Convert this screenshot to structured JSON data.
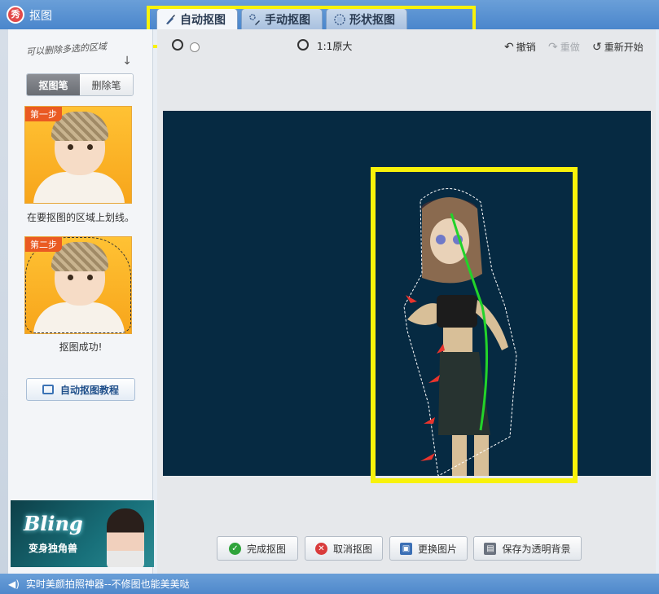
{
  "window": {
    "title": "抠图",
    "logo_text": "秀"
  },
  "tabs": [
    {
      "label": "自动抠图",
      "icon": "brush-icon",
      "active": true
    },
    {
      "label": "手动抠图",
      "icon": "pen-icon",
      "active": false
    },
    {
      "label": "形状抠图",
      "icon": "shape-icon",
      "active": false
    }
  ],
  "left_panel": {
    "hint": "可以删除多选的区域",
    "brushes": [
      {
        "label": "抠图笔",
        "selected": true
      },
      {
        "label": "删除笔",
        "selected": false
      }
    ],
    "steps": [
      {
        "badge": "第一步",
        "caption": "在要抠图的区域上划线。"
      },
      {
        "badge": "第二步",
        "caption": "抠图成功!"
      }
    ],
    "tutorial_label": "自动抠图教程",
    "ad": {
      "title": "Bling",
      "subtitle": "变身独角兽"
    }
  },
  "toolbar": {
    "zoom_label": "1:1原大",
    "undo_label": "撤销",
    "redo_label": "重做",
    "restart_label": "重新开始"
  },
  "canvas": {
    "background": "#062a42",
    "highlight_color": "#f8f20a"
  },
  "bottom_buttons": [
    {
      "label": "完成抠图",
      "icon": "check-icon",
      "color": "#2fa33a"
    },
    {
      "label": "取消抠图",
      "icon": "cancel-icon",
      "color": "#d93b3b"
    },
    {
      "label": "更换图片",
      "icon": "image-icon",
      "color": "#3b6fb5"
    },
    {
      "label": "保存为透明背景",
      "icon": "save-icon",
      "color": "#6b7380"
    }
  ],
  "status": {
    "text": "实时美颜拍照神器--不修图也能美美哒"
  }
}
